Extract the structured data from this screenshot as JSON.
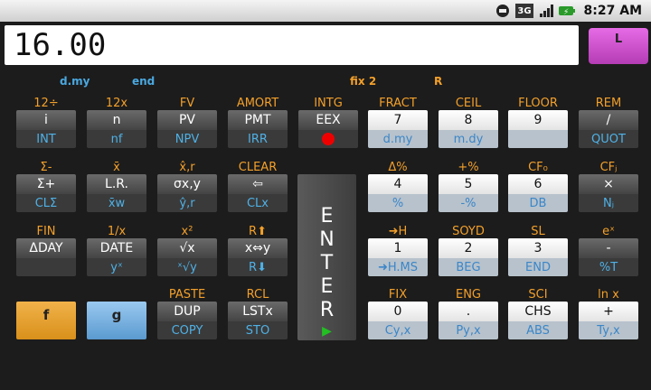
{
  "status": {
    "clock": "8:27 AM",
    "signal": "3G"
  },
  "display": {
    "value": "16.00"
  },
  "mode_button": {
    "label": "L"
  },
  "annunciators": [
    {
      "text": "d.my",
      "color": "#4aa8e0"
    },
    {
      "text": "end",
      "color": "#4aa8e0"
    },
    {
      "text": "fix 2",
      "color": "#f3a02a"
    },
    {
      "text": "R",
      "color": "#f3a02a"
    }
  ],
  "f_labels": [
    "12÷",
    "12x",
    "FV",
    "AMORT",
    "INTG",
    "FRACT",
    "CEIL",
    "FLOOR",
    "REM",
    "Σ-",
    "x̄",
    "x̂,r",
    "CLEAR",
    "Δ%",
    "+%",
    "CF₀",
    "CFⱼ",
    "FIN",
    "1/x",
    "x²",
    "R⬆",
    "➜H",
    "SOYD",
    "SL",
    "eˣ",
    "PASTE",
    "RCL",
    "FIX",
    "ENG",
    "SCI",
    "ln x"
  ],
  "keys": [
    {
      "top": "i",
      "bottom": "INT"
    },
    {
      "top": "n",
      "bottom": "nf"
    },
    {
      "top": "PV",
      "bottom": "NPV"
    },
    {
      "top": "PMT",
      "bottom": "IRR"
    },
    {
      "top": "EEX",
      "bottom": ""
    },
    {
      "top": "7",
      "bottom": "d.my"
    },
    {
      "top": "8",
      "bottom": "m.dy"
    },
    {
      "top": "9",
      "bottom": ""
    },
    {
      "top": "/",
      "bottom": "QUOT"
    },
    {
      "top": "Σ+",
      "bottom": "CLΣ"
    },
    {
      "top": "L.R.",
      "bottom": "x̄w"
    },
    {
      "top": "σx,y",
      "bottom": "ŷ,r"
    },
    {
      "top": "⇦",
      "bottom": "CLx"
    },
    {
      "top": "4",
      "bottom": "%"
    },
    {
      "top": "5",
      "bottom": "-%"
    },
    {
      "top": "6",
      "bottom": "DB"
    },
    {
      "top": "×",
      "bottom": "Nⱼ"
    },
    {
      "top": "ΔDAY",
      "bottom": ""
    },
    {
      "top": "DATE",
      "bottom": "yˣ"
    },
    {
      "top": "√x",
      "bottom": "ˣ√y"
    },
    {
      "top": "x⇔y",
      "bottom": "R⬇"
    },
    {
      "top": "1",
      "bottom": "➜H.MS"
    },
    {
      "top": "2",
      "bottom": "BEG"
    },
    {
      "top": "3",
      "bottom": "END"
    },
    {
      "top": "-",
      "bottom": "%T"
    },
    {
      "top": "DUP",
      "bottom": "COPY"
    },
    {
      "top": "LSTx",
      "bottom": "STO"
    },
    {
      "top": "0",
      "bottom": "Cy,x"
    },
    {
      "top": ".",
      "bottom": "Py,x"
    },
    {
      "top": "CHS",
      "bottom": "ABS"
    },
    {
      "top": "+",
      "bottom": "Ty,x"
    }
  ],
  "shift_keys": {
    "f": "f",
    "g": "g"
  },
  "enter": {
    "letters": [
      "E",
      "N",
      "T",
      "E",
      "R"
    ]
  }
}
